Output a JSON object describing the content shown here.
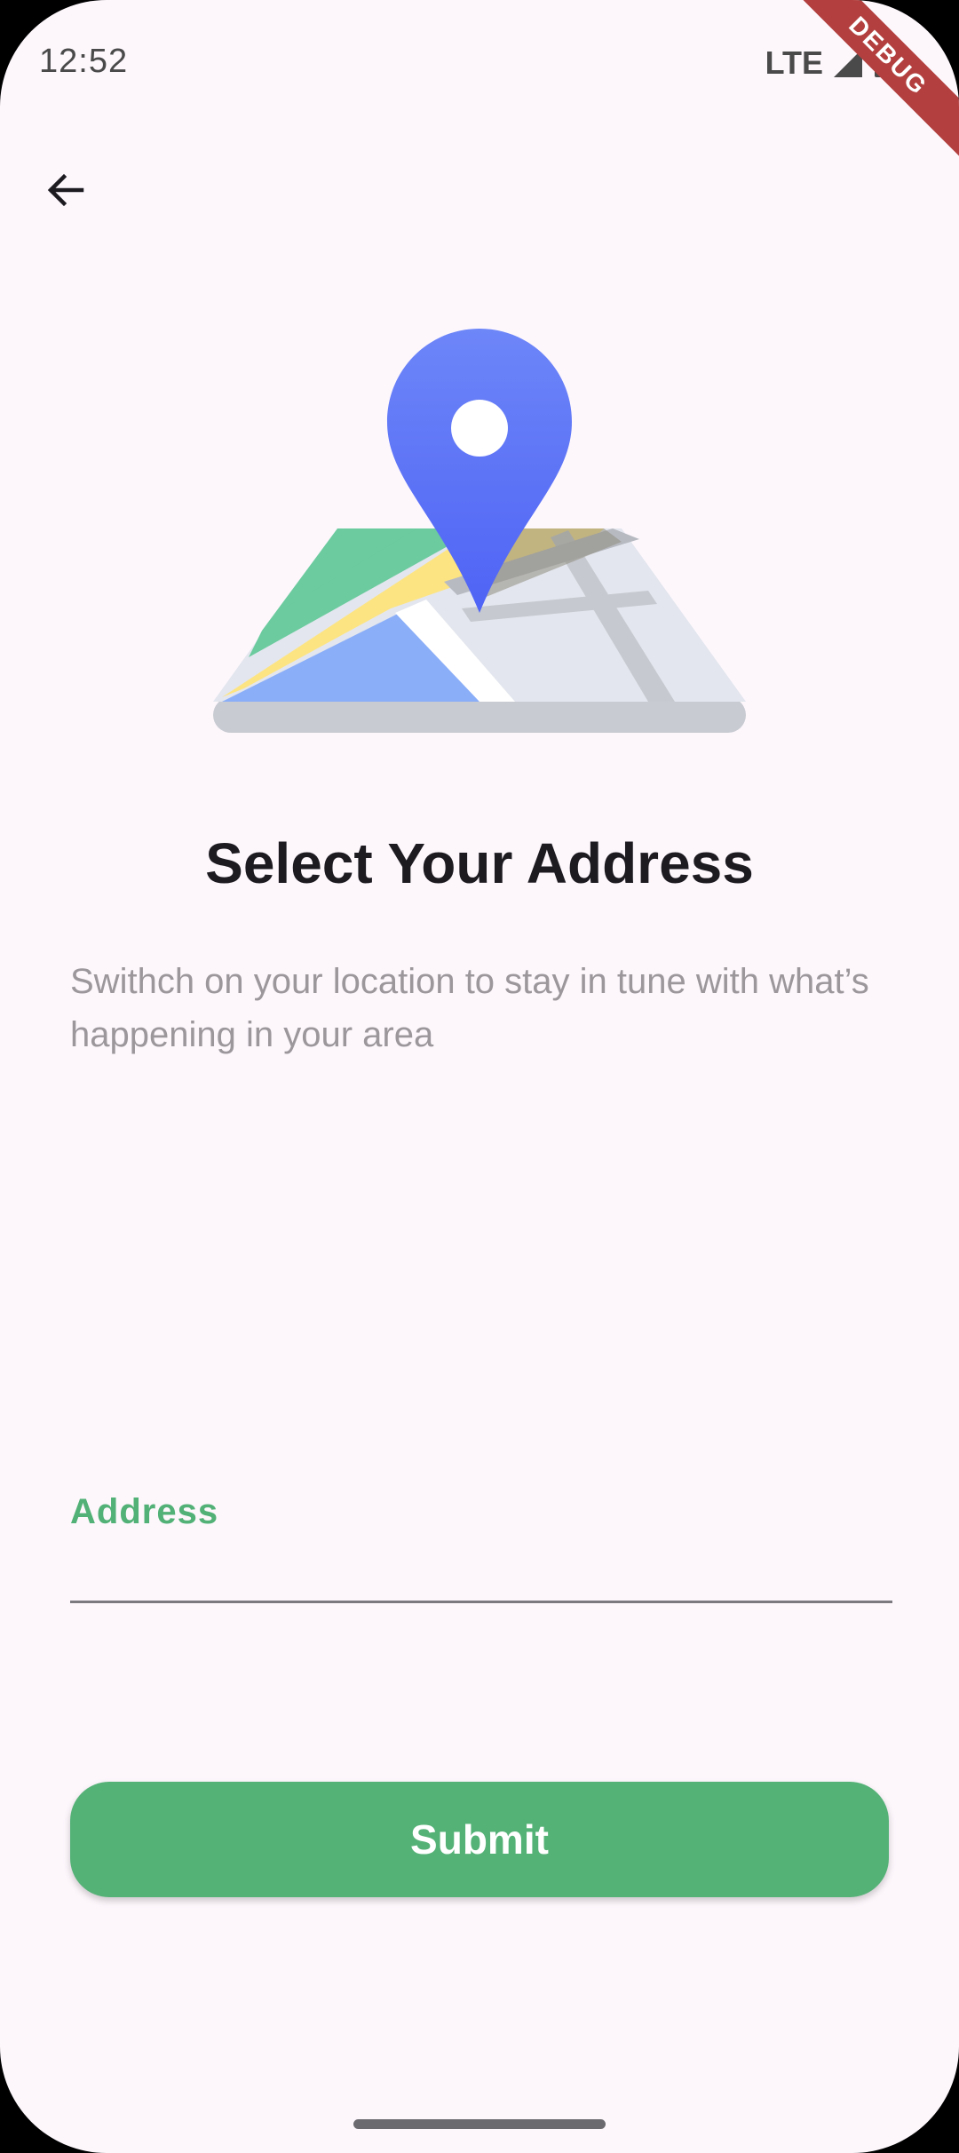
{
  "status_bar": {
    "time": "12:52",
    "network": "LTE",
    "debug_label": "DEBUG"
  },
  "header": {
    "back_icon": "arrow-left-icon"
  },
  "illustration": {
    "icon": "map-pin-illustration"
  },
  "main": {
    "title": "Select Your Address",
    "description": "Swithch on your location to stay in tune with what’s happening in your area"
  },
  "form": {
    "address_label": "Address",
    "address_value": "",
    "submit_label": "Submit"
  },
  "colors": {
    "accent": "#55b277",
    "background": "#fdf7fc",
    "pin": "#5b74f7"
  }
}
